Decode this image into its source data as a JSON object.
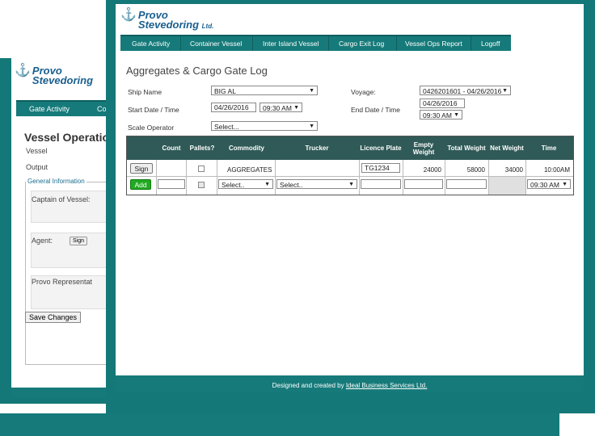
{
  "back_window": {
    "logo": {
      "line1": "Provo",
      "line2": "Stevedoring"
    },
    "nav": {
      "items": [
        "Gate Activity",
        "Co"
      ]
    },
    "title": "Vessel Operatio",
    "labels": {
      "vessel": "Vessel",
      "output": "Output"
    },
    "section_legend": "General Information",
    "fields": {
      "captain": "Captain of Vessel:",
      "agent": "Agent:",
      "agent_sign": "Sign",
      "provo_rep": "Provo Representat"
    },
    "save_button": "Save Changes"
  },
  "front_window": {
    "logo": {
      "line1": "Provo",
      "line2": "Stevedoring",
      "ltd": "Ltd."
    },
    "nav": [
      "Gate Activity",
      "Container Vessel",
      "Inter Island Vessel",
      "Cargo Exit Log",
      "Vessel Ops Report",
      "Logoff"
    ],
    "page_title": "Aggregates & Cargo Gate Log",
    "form": {
      "ship_name_label": "Ship Name",
      "ship_name_value": "BIG AL",
      "voyage_label": "Voyage:",
      "voyage_value": "0426201601 - 04/26/2016",
      "start_label": "Start Date / Time",
      "start_date": "04/26/2016",
      "start_time": "09:30 AM",
      "end_label": "End Date / Time",
      "end_date": "04/26/2016",
      "end_time": "09:30 AM",
      "scale_label": "Scale Operator",
      "scale_value": "Select..."
    },
    "table": {
      "headers": [
        "",
        "Count",
        "Pallets?",
        "Commodity",
        "Trucker",
        "Licence Plate",
        "Empty Weight",
        "Total Weight",
        "Net Weight",
        "Time"
      ],
      "row1": {
        "button": "Sign",
        "count": "",
        "commodity": "AGGREGATES",
        "trucker": "",
        "plate": "TG1234",
        "empty": "24000",
        "total": "58000",
        "net": "34000",
        "time": "10:00AM"
      },
      "row2": {
        "button": "Add",
        "commodity": "Select..",
        "trucker": "Select..",
        "time": "09:30 AM"
      }
    },
    "footer": {
      "prefix": "Designed and created by ",
      "link": "Ideal Business Services Ltd."
    }
  },
  "colors": {
    "teal": "#167a7a",
    "header": "#2f5a57",
    "add_green": "#22aa22"
  }
}
